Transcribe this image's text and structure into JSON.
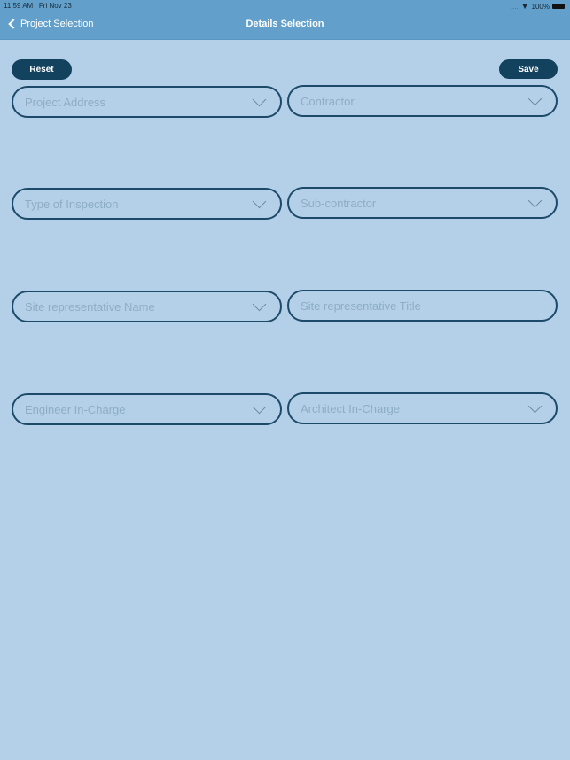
{
  "status_bar": {
    "time": "11:59 AM",
    "date": "Fri Nov 23",
    "battery": "100%"
  },
  "nav": {
    "back_label": "Project Selection",
    "title": "Details Selection"
  },
  "toolbar": {
    "reset_label": "Reset",
    "save_label": "Save"
  },
  "fields": [
    {
      "placeholder": "Project Address",
      "type": "dropdown"
    },
    {
      "placeholder": "Contractor",
      "type": "dropdown"
    },
    {
      "placeholder": "Type of Inspection",
      "type": "dropdown"
    },
    {
      "placeholder": "Sub-contractor",
      "type": "dropdown"
    },
    {
      "placeholder": "Site representative Name",
      "type": "dropdown"
    },
    {
      "placeholder": "Site representative Title",
      "type": "text"
    },
    {
      "placeholder": "Engineer In-Charge",
      "type": "dropdown"
    },
    {
      "placeholder": "Architect In-Charge",
      "type": "dropdown"
    }
  ]
}
